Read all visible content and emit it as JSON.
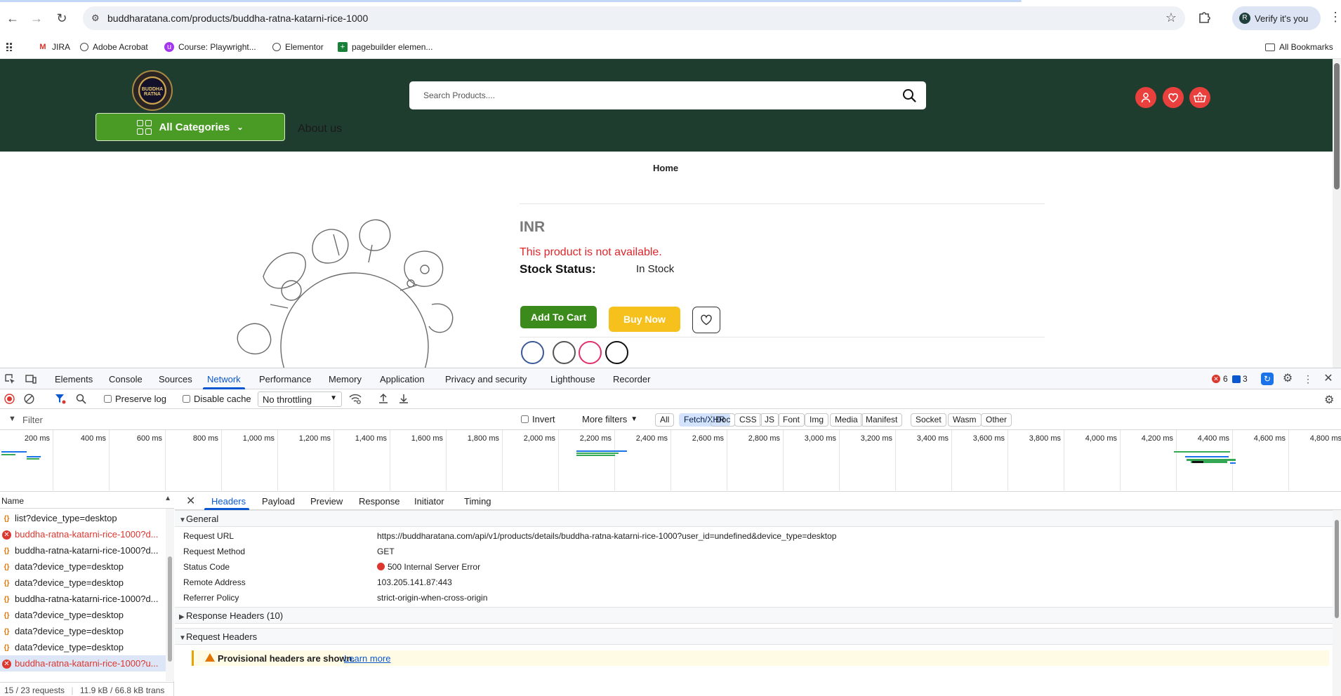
{
  "browser": {
    "url": "buddharatana.com/products/buddha-ratna-katarni-rice-1000",
    "verify_label": "Verify it's you",
    "bookmarks": [
      "JIRA",
      "Adobe Acrobat",
      "Course: Playwright...",
      "Elementor",
      "pagebuilder elemen..."
    ],
    "all_bookmarks_label": "All Bookmarks"
  },
  "site": {
    "logo_text": "BUDDHA RATNA",
    "all_categories_label": "All Categories",
    "about_label": "About us",
    "search_placeholder": "Search Products....",
    "breadcrumb": "Home",
    "currency": "INR",
    "unavailable_text": "This product is not available.",
    "stock_label": "Stock Status:",
    "stock_value": "In Stock",
    "add_to_cart_label": "Add To Cart",
    "buy_now_label": "Buy Now",
    "colors": {
      "header_bg": "#1f3d2f",
      "accent_green": "#4a9a26",
      "cart_green": "#3b8a1c",
      "buy_yellow": "#f7c11d",
      "icon_red": "#e9403e",
      "error_red": "#e0262a"
    }
  },
  "devtools": {
    "tabs": [
      "Elements",
      "Console",
      "Sources",
      "Network",
      "Performance",
      "Memory",
      "Application",
      "Privacy and security",
      "Lighthouse",
      "Recorder"
    ],
    "active_tab": "Network",
    "error_count": "6",
    "message_count": "3",
    "toolbar": {
      "preserve_log": "Preserve log",
      "disable_cache": "Disable cache",
      "throttling": "No throttling"
    },
    "filter": {
      "placeholder": "Filter",
      "invert": "Invert",
      "more_filters": "More filters",
      "types": [
        "All",
        "Fetch/XHR",
        "Doc",
        "CSS",
        "JS",
        "Font",
        "Img",
        "Media",
        "Manifest",
        "Socket",
        "Wasm",
        "Other"
      ],
      "active_type": "Fetch/XHR"
    },
    "timeline_labels": [
      "200 ms",
      "400 ms",
      "600 ms",
      "800 ms",
      "1,000 ms",
      "1,200 ms",
      "1,400 ms",
      "1,600 ms",
      "1,800 ms",
      "2,000 ms",
      "2,200 ms",
      "2,400 ms",
      "2,600 ms",
      "2,800 ms",
      "3,000 ms",
      "3,200 ms",
      "3,400 ms",
      "3,600 ms",
      "3,800 ms",
      "4,000 ms",
      "4,200 ms",
      "4,400 ms",
      "4,600 ms",
      "4,800 ms"
    ],
    "name_header": "Name",
    "requests": [
      {
        "name": "list?device_type=desktop",
        "status": "ok"
      },
      {
        "name": "buddha-ratna-katarni-rice-1000?d...",
        "status": "error"
      },
      {
        "name": "buddha-ratna-katarni-rice-1000?d...",
        "status": "ok"
      },
      {
        "name": "data?device_type=desktop",
        "status": "ok"
      },
      {
        "name": "data?device_type=desktop",
        "status": "ok"
      },
      {
        "name": "buddha-ratna-katarni-rice-1000?d...",
        "status": "ok"
      },
      {
        "name": "data?device_type=desktop",
        "status": "ok"
      },
      {
        "name": "data?device_type=desktop",
        "status": "ok"
      },
      {
        "name": "data?device_type=desktop",
        "status": "ok"
      },
      {
        "name": "buddha-ratna-katarni-rice-1000?u...",
        "status": "error"
      }
    ],
    "summary_requests": "15 / 23 requests",
    "summary_size": "11.9 kB / 66.8 kB trans",
    "detail_tabs": [
      "Headers",
      "Payload",
      "Preview",
      "Response",
      "Initiator",
      "Timing"
    ],
    "active_detail_tab": "Headers",
    "general_label": "General",
    "general": [
      {
        "key": "Request URL",
        "value": "https://buddharatana.com/api/v1/products/details/buddha-ratna-katarni-rice-1000?user_id=undefined&device_type=desktop"
      },
      {
        "key": "Request Method",
        "value": "GET"
      },
      {
        "key": "Status Code",
        "value": "500 Internal Server Error"
      },
      {
        "key": "Remote Address",
        "value": "103.205.141.87:443"
      },
      {
        "key": "Referrer Policy",
        "value": "strict-origin-when-cross-origin"
      }
    ],
    "response_headers_label": "Response Headers (10)",
    "request_headers_label": "Request Headers",
    "provisional_text": "Provisional headers are shown.",
    "learn_more": "Learn more"
  }
}
